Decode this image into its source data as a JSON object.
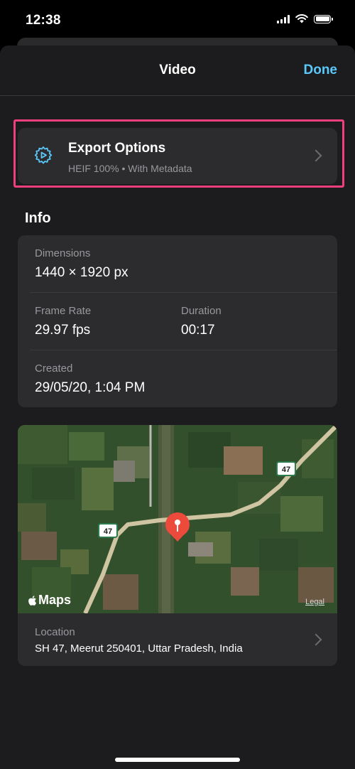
{
  "status_bar": {
    "time": "12:38"
  },
  "nav": {
    "title": "Video",
    "done_label": "Done"
  },
  "export_options": {
    "title": "Export Options",
    "subtitle": "HEIF 100% • With Metadata",
    "icon": "gear-play-icon"
  },
  "info": {
    "section_title": "Info",
    "dimensions_label": "Dimensions",
    "dimensions_value": "1440 × 1920 px",
    "frame_rate_label": "Frame Rate",
    "frame_rate_value": "29.97 fps",
    "duration_label": "Duration",
    "duration_value": "00:17",
    "created_label": "Created",
    "created_value": "29/05/20, 1:04 PM"
  },
  "map": {
    "maps_brand": "Maps",
    "legal_label": "Legal",
    "route_shield_left": "47",
    "route_shield_right": "47",
    "location_label": "Location",
    "location_value": "SH 47, Meerut 250401, Uttar Pradesh, India"
  },
  "colors": {
    "accent": "#5ac8fa",
    "highlight": "#ef3f7d",
    "pin": "#ec4b3c"
  }
}
